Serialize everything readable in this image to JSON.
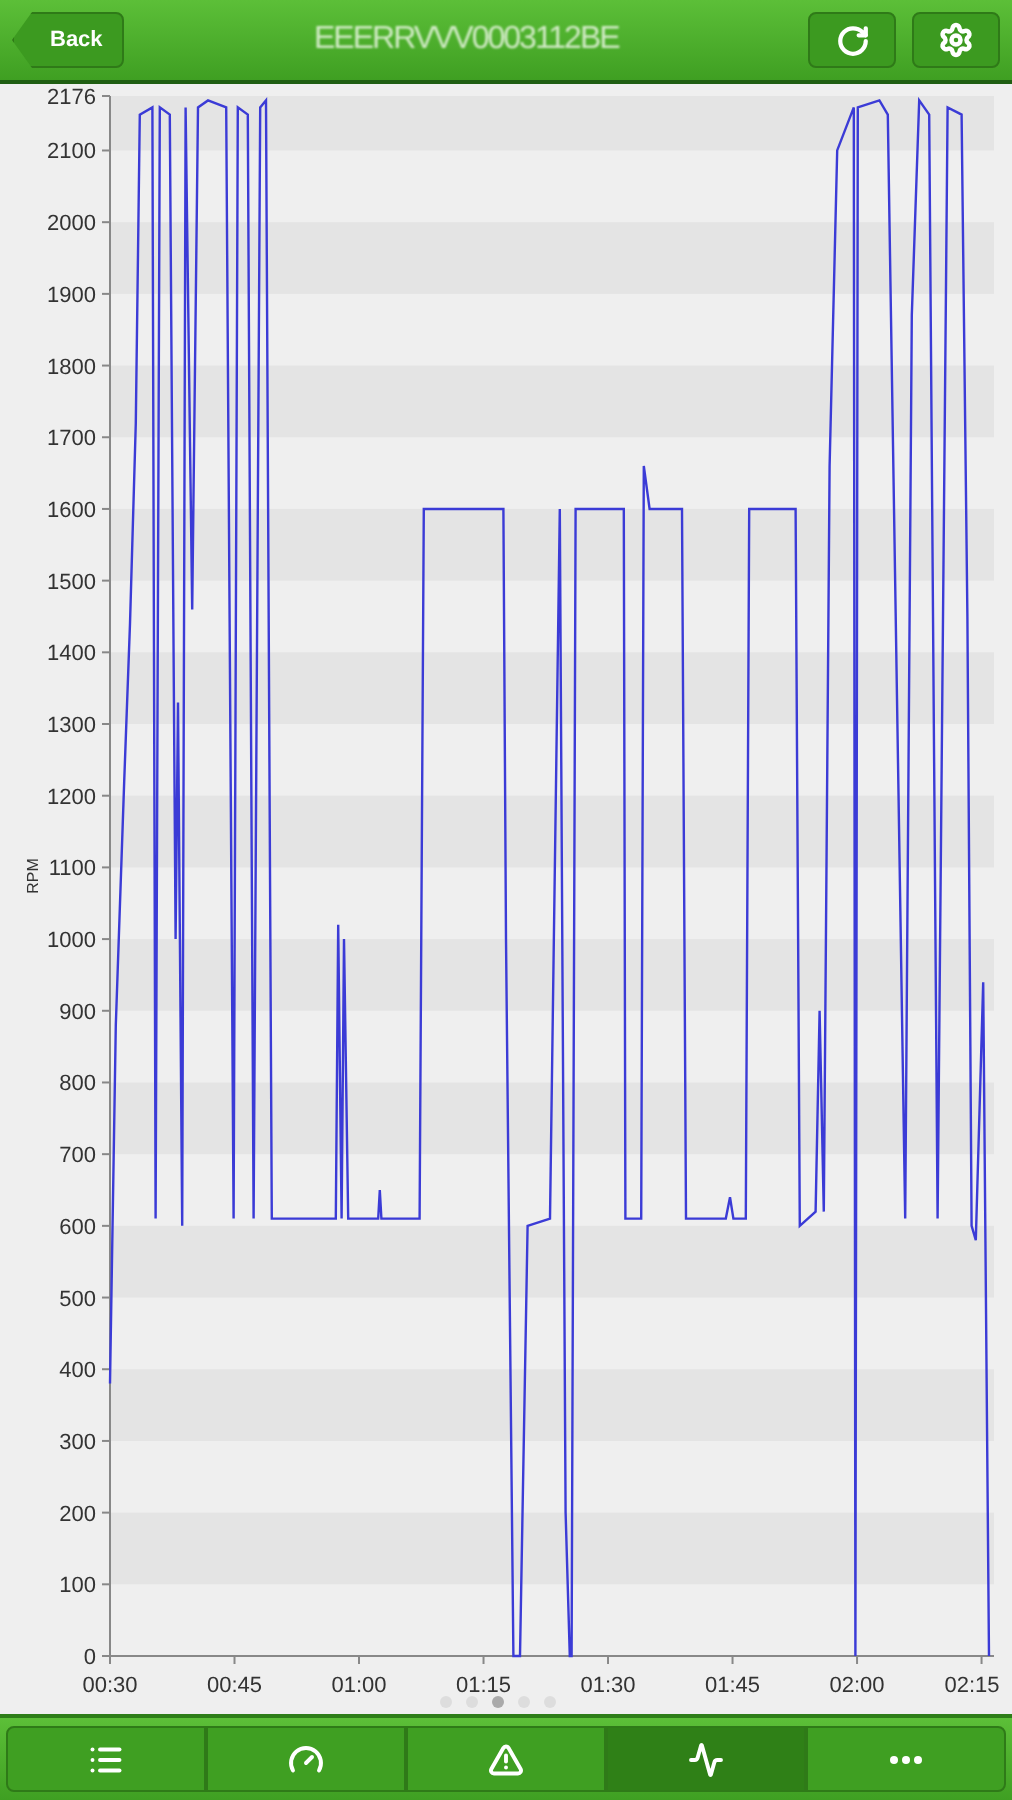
{
  "header": {
    "back_label": "Back",
    "title": "EEERRVVV0003112BE"
  },
  "chart": {
    "chart_data": {
      "type": "line",
      "ylabel": "RPM",
      "xlim": [
        30,
        136.5
      ],
      "ylim": [
        0,
        2176
      ],
      "xticks": [
        {
          "value": 30,
          "label": "00:30"
        },
        {
          "value": 45,
          "label": "00:45"
        },
        {
          "value": 60,
          "label": "01:00"
        },
        {
          "value": 75,
          "label": "01:15"
        },
        {
          "value": 90,
          "label": "01:30"
        },
        {
          "value": 105,
          "label": "01:45"
        },
        {
          "value": 120,
          "label": "02:00"
        },
        {
          "value": 135,
          "label": "02:15"
        }
      ],
      "yticks": [
        0,
        100,
        200,
        300,
        400,
        500,
        600,
        700,
        800,
        900,
        1000,
        1100,
        1200,
        1300,
        1400,
        1500,
        1600,
        1700,
        1800,
        1900,
        2000,
        2100,
        2176
      ],
      "x": [
        30,
        30.7,
        31.7,
        32.4,
        33.1,
        33.6,
        35.1,
        35.5,
        36,
        37.2,
        37.9,
        38.2,
        38.7,
        39.1,
        39.9,
        40.6,
        41.8,
        44,
        44.9,
        45.4,
        46.6,
        47.3,
        48.1,
        48.8,
        49.5,
        57.2,
        57.5,
        57.9,
        58.2,
        58.7,
        62.3,
        62.5,
        62.7,
        67.3,
        67.8,
        77,
        77.4,
        77.7,
        78.6,
        79.4,
        80.3,
        83,
        84.2,
        84.9,
        85.4,
        85.6,
        86.1,
        91.9,
        92.1,
        94,
        94.3,
        95,
        98.9,
        99.4,
        104.2,
        104.7,
        105.1,
        106.6,
        107,
        112.6,
        113.1,
        115,
        115.5,
        116,
        116.7,
        117.6,
        119.6,
        119.8,
        120.1,
        122.7,
        123.7,
        125.8,
        126.6,
        127.5,
        128.7,
        129.7,
        130.9,
        132.6,
        133.3,
        133.8,
        134.3,
        135.2,
        135.9
      ],
      "series": [
        {
          "color": "#3b3bd6",
          "values": [
            380,
            880,
            1220,
            1440,
            1720,
            2150,
            2160,
            610,
            2160,
            2150,
            1000,
            1330,
            600,
            2160,
            1460,
            2160,
            2170,
            2160,
            610,
            2160,
            2150,
            610,
            2160,
            2170,
            610,
            610,
            1020,
            610,
            1000,
            610,
            610,
            650,
            610,
            610,
            1600,
            1600,
            1600,
            1000,
            0,
            0,
            600,
            610,
            1600,
            200,
            0,
            0,
            1600,
            1600,
            610,
            610,
            1660,
            1600,
            1600,
            610,
            610,
            640,
            610,
            610,
            1600,
            1600,
            600,
            620,
            900,
            620,
            1660,
            2100,
            2160,
            0,
            2160,
            2170,
            2150,
            610,
            1870,
            2170,
            2150,
            610,
            2160,
            2150,
            1450,
            600,
            580,
            940,
            0
          ]
        }
      ]
    }
  },
  "pager": [
    {
      "selected": false
    },
    {
      "selected": false
    },
    {
      "selected": true
    },
    {
      "selected": false
    },
    {
      "selected": false
    }
  ],
  "tabs": [
    {
      "kind": "list",
      "selected": false
    },
    {
      "kind": "gauge",
      "selected": false
    },
    {
      "kind": "warning",
      "selected": false
    },
    {
      "kind": "graph",
      "selected": true
    },
    {
      "kind": "more",
      "selected": false
    }
  ]
}
